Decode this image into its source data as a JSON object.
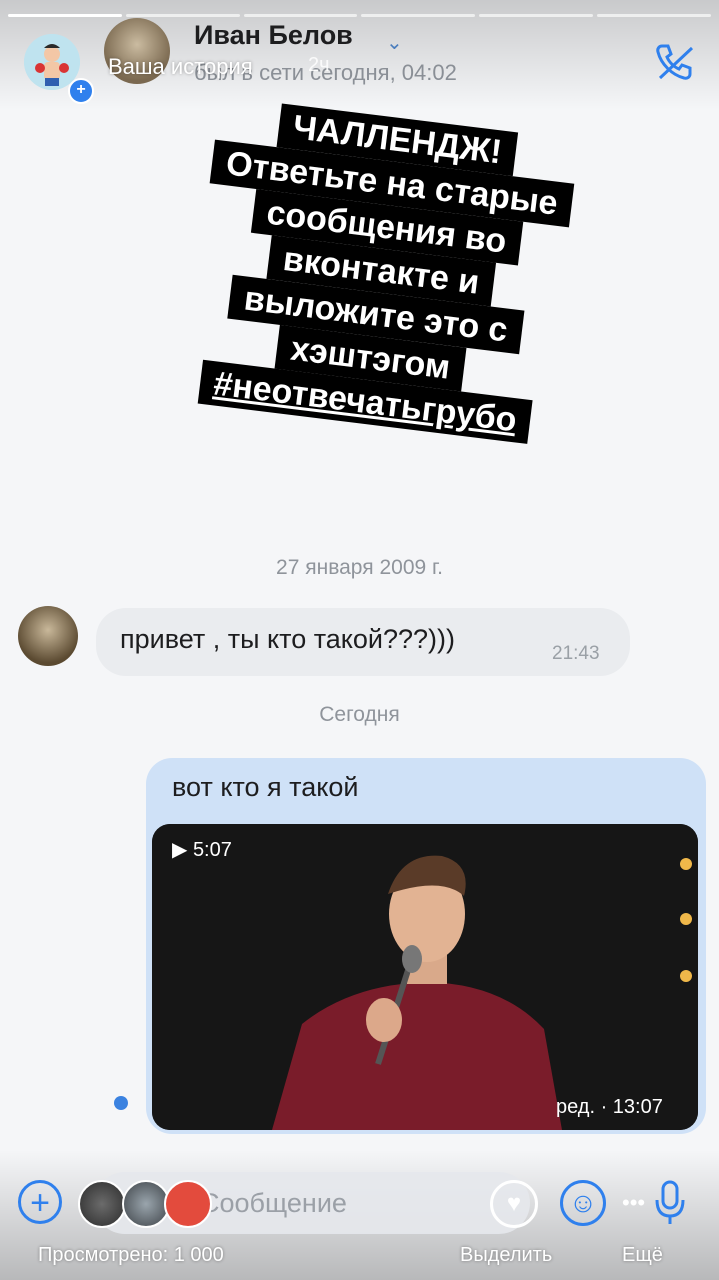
{
  "story": {
    "label": "Ваша история",
    "age": "2ч",
    "progress_segments": 6,
    "progress_done": 1
  },
  "chat": {
    "peer_name": "Иван Белов",
    "last_seen": "был в сети сегодня, 04:02",
    "date_separator": "27 января 2009 г.",
    "today_separator": "Сегодня",
    "incoming": {
      "text": "привет , ты кто такой???)))",
      "time": "21:43"
    },
    "outgoing": {
      "text": "вот кто я такой",
      "video_duration": "5:07",
      "edit_time": "ред. · 13:07"
    },
    "input_placeholder": "Сообщение"
  },
  "challenge": {
    "lines": [
      "ЧАЛЛЕНДЖ!",
      "Ответьте на старые",
      "сообщения во",
      "вконтакте и",
      "выложите это с",
      "хэштэгом",
      "#неотвечатьгрубо"
    ]
  },
  "footer": {
    "views": "Просмотрено: 1 000",
    "highlight": "Выделить",
    "more": "Ещё"
  },
  "colors": {
    "accent": "#2f80ed",
    "bubble_out": "#cfe1f7",
    "bubble_in": "#eaecef"
  }
}
